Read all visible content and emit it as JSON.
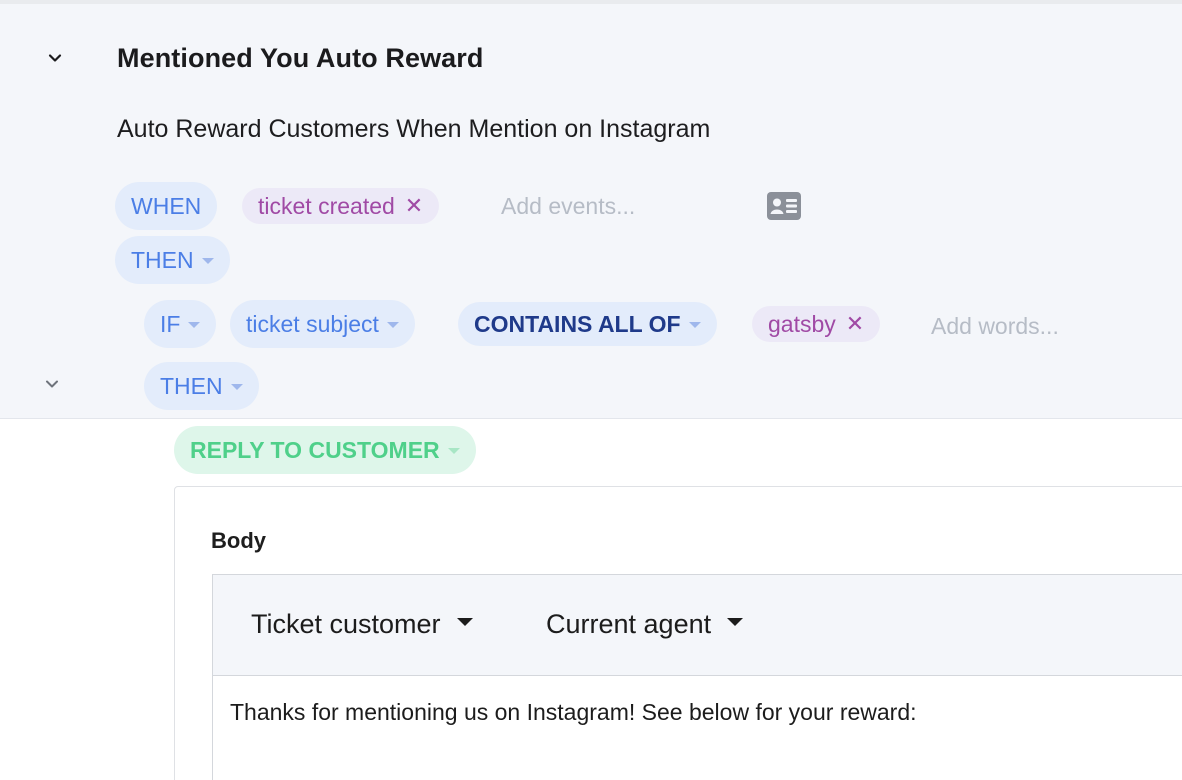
{
  "rule": {
    "title": "Mentioned You Auto Reward",
    "description": "Auto Reward Customers When Mention on Instagram"
  },
  "trigger": {
    "when_label": "WHEN",
    "events": [
      {
        "label": "ticket created"
      }
    ],
    "events_placeholder": "Add events...",
    "card_icon": "id-card-icon"
  },
  "flow": {
    "then_label": "THEN",
    "condition": {
      "if_label": "IF",
      "field": "ticket subject",
      "operator": "CONTAINS ALL OF",
      "words": [
        {
          "label": "gatsby"
        }
      ],
      "words_placeholder": "Add words..."
    },
    "inner_then_label": "THEN",
    "action": {
      "label": "REPLY TO CUSTOMER",
      "body_label": "Body",
      "toolbar": {
        "variable_menu_1": "Ticket customer",
        "variable_menu_2": "Current agent"
      },
      "body_text": "Thanks for mentioning us on Instagram! See below for your reward:"
    }
  },
  "icons": {
    "collapse": "chevron-down-icon",
    "remove": "close-icon"
  },
  "colors": {
    "panel_bg": "#f4f6fa",
    "pill_blue_bg": "#e3ecfb",
    "pill_blue_text": "#4b7ee6",
    "operator_text": "#1f3a8a",
    "tag_bg": "#ece9f7",
    "tag_text": "#a04aa5",
    "action_bg": "#def6ea",
    "action_text": "#4fd08a",
    "placeholder": "#b6bcc6"
  }
}
